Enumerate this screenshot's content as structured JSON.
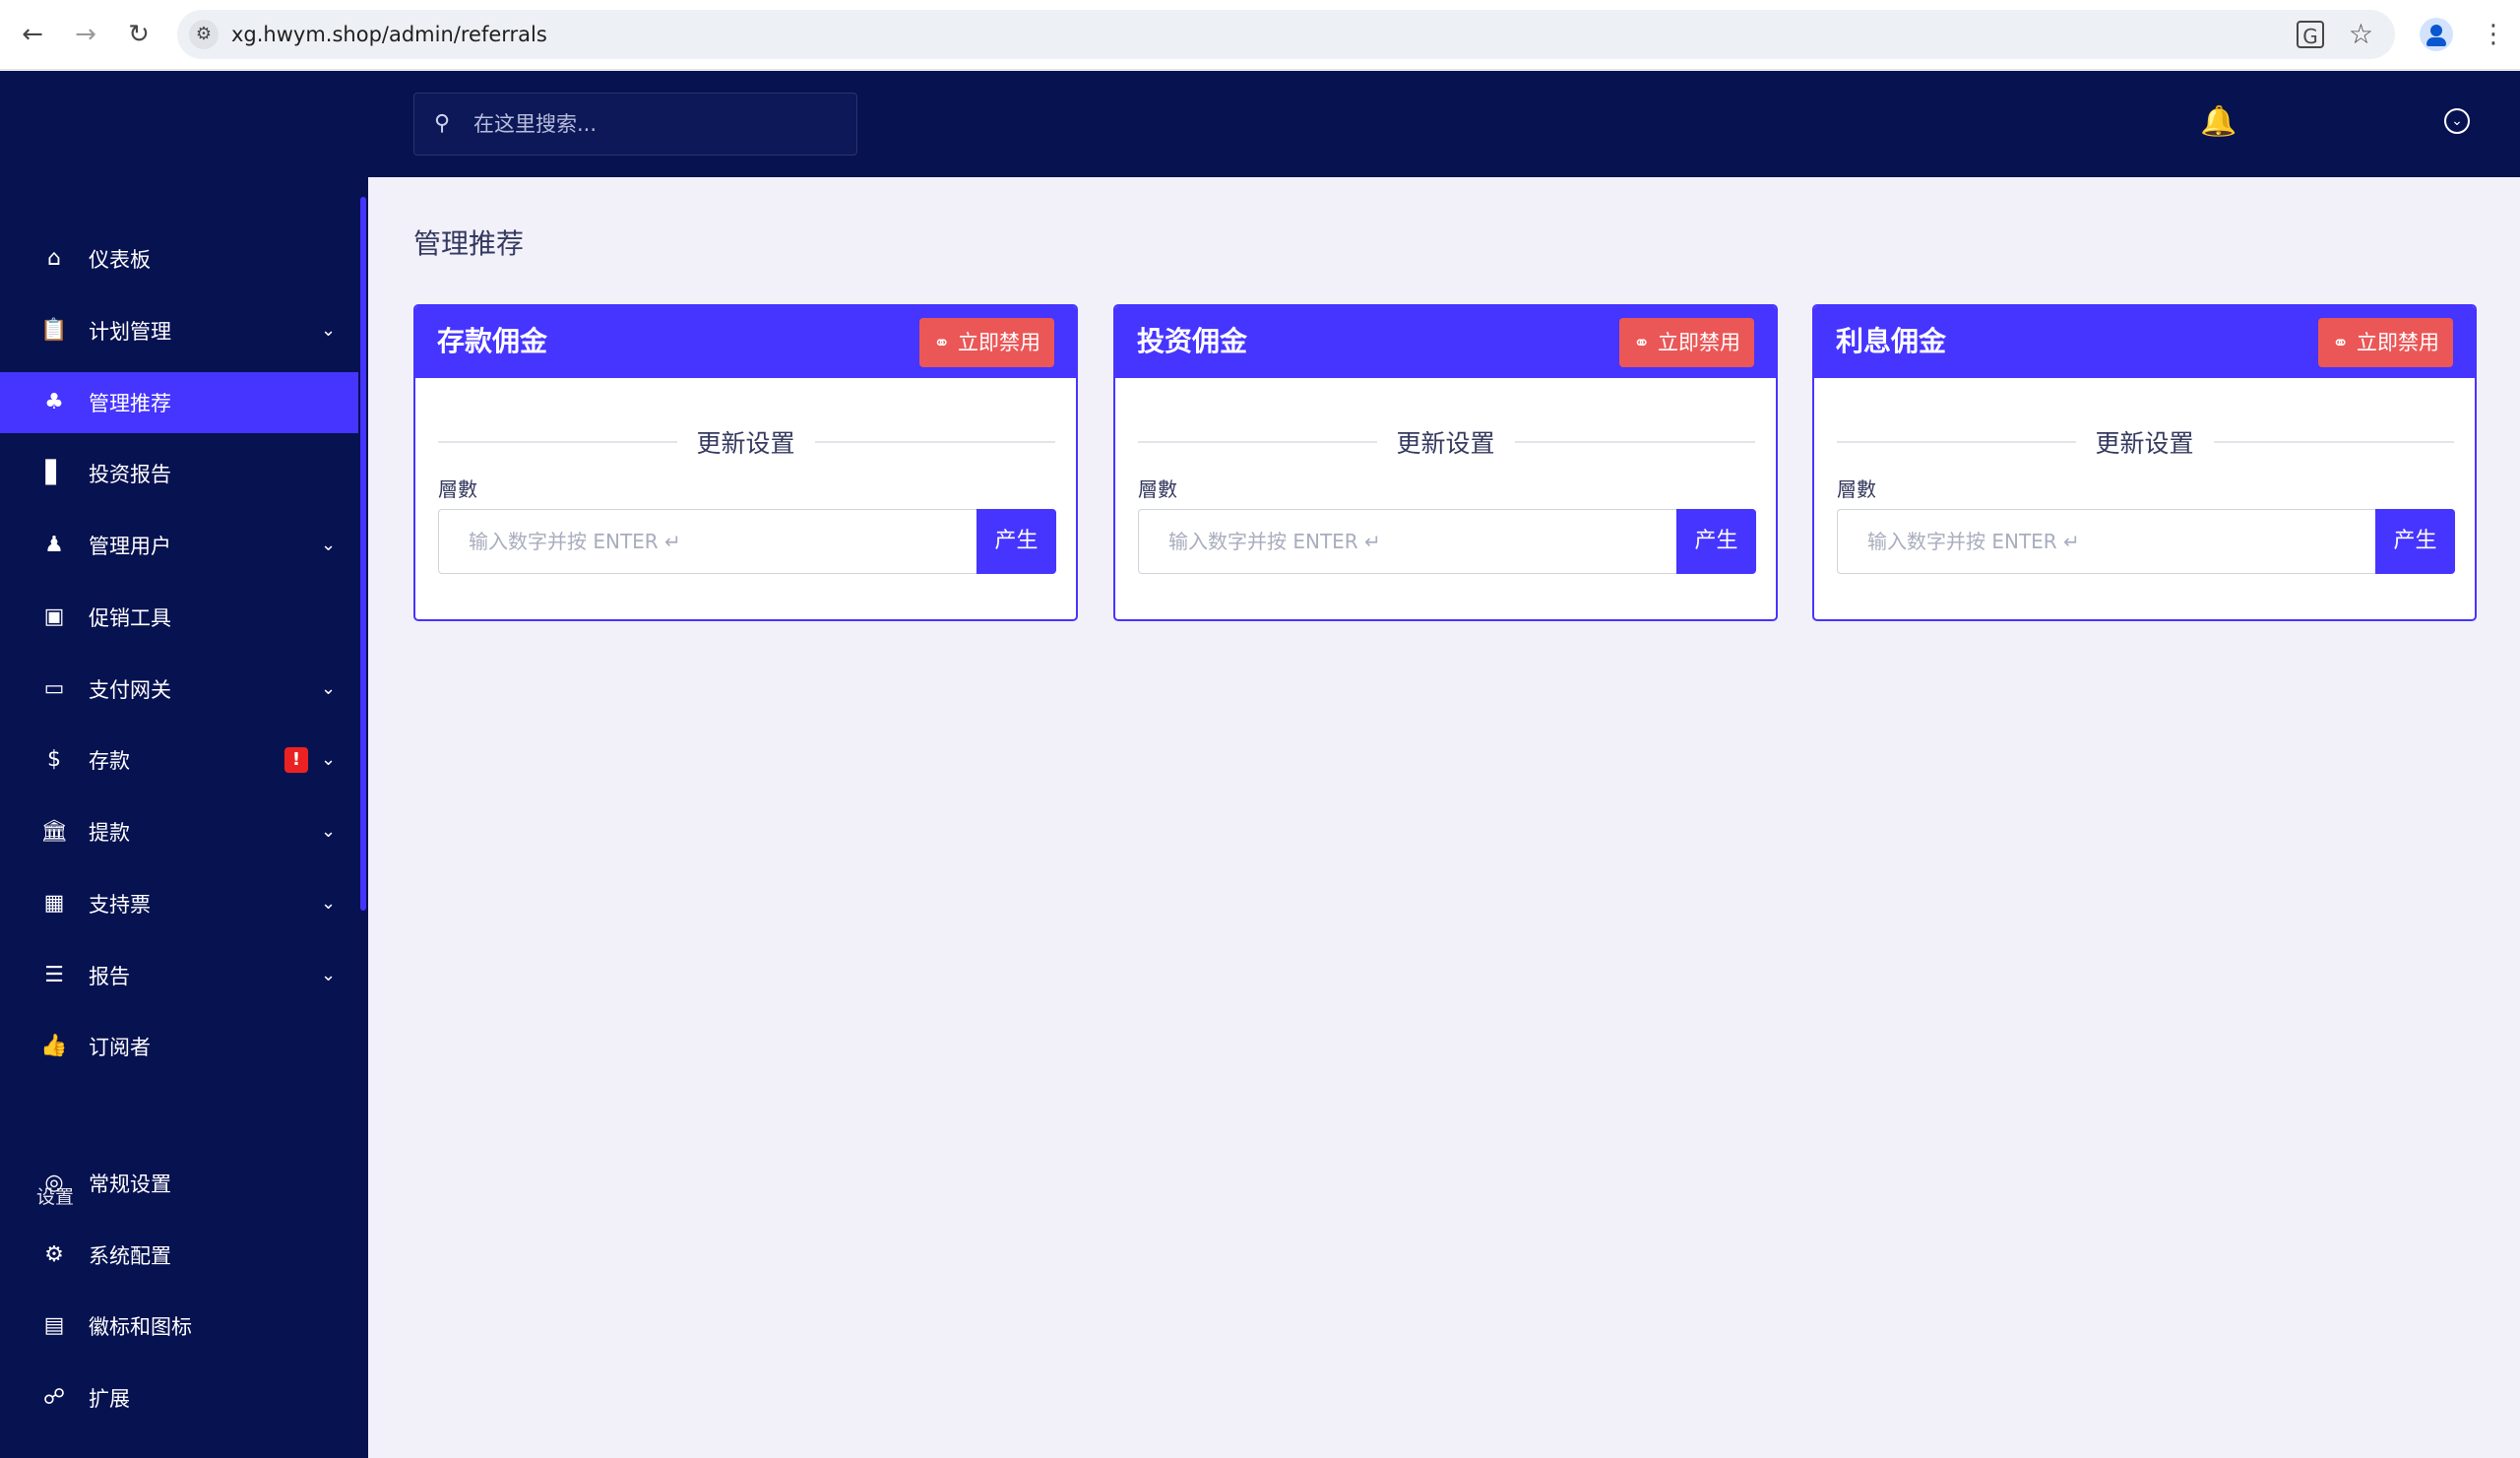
{
  "browser": {
    "url": "xg.hwym.shop/admin/referrals"
  },
  "sidebar": {
    "items": [
      {
        "label": "仪表板",
        "icon": "home-icon",
        "top": 0
      },
      {
        "label": "计划管理",
        "icon": "clipboard-icon"
      },
      {
        "label": "管理推荐",
        "icon": "referral-icon"
      },
      {
        "label": "投资报告",
        "icon": "bar-chart-icon"
      },
      {
        "label": "管理用户",
        "icon": "users-icon"
      },
      {
        "label": "促销工具",
        "icon": "image-icon"
      },
      {
        "label": "支付网关",
        "icon": "credit-card-icon"
      },
      {
        "label": "存款",
        "icon": "deposit-icon"
      },
      {
        "label": "提款",
        "icon": "bank-icon"
      },
      {
        "label": "支持票",
        "icon": "ticket-icon"
      },
      {
        "label": "报告",
        "icon": "list-icon"
      },
      {
        "label": "订阅者",
        "icon": "thumbs-up-icon"
      }
    ],
    "section_label": "设置",
    "settings_items": [
      {
        "label": "常规设置",
        "icon": "lifebuoy-icon"
      },
      {
        "label": "系统配置",
        "icon": "gear-icon"
      },
      {
        "label": "徽标和图标",
        "icon": "images-icon"
      },
      {
        "label": "扩展",
        "icon": "extension-icon"
      }
    ],
    "deposit_alert": "!"
  },
  "topbar": {
    "search_placeholder": "在这里搜索..."
  },
  "main": {
    "page_title": "管理推荐",
    "cards": [
      {
        "title": "存款佣金",
        "disable_label": "立即禁用",
        "section_label": "更新设置",
        "field_label": "層數",
        "input_placeholder": "输入数字并按 ENTER ↵",
        "button_label": "产生"
      },
      {
        "title": "投资佣金",
        "disable_label": "立即禁用",
        "section_label": "更新设置",
        "field_label": "層數",
        "input_placeholder": "输入数字并按 ENTER ↵",
        "button_label": "产生"
      },
      {
        "title": "利息佣金",
        "disable_label": "立即禁用",
        "section_label": "更新设置",
        "field_label": "層數",
        "input_placeholder": "输入数字并按 ENTER ↵",
        "button_label": "产生"
      }
    ]
  },
  "colors": {
    "sidebar_bg": "#071251",
    "accent": "#4634ff",
    "danger": "#eb5757",
    "page_bg": "#f2f1fa"
  }
}
